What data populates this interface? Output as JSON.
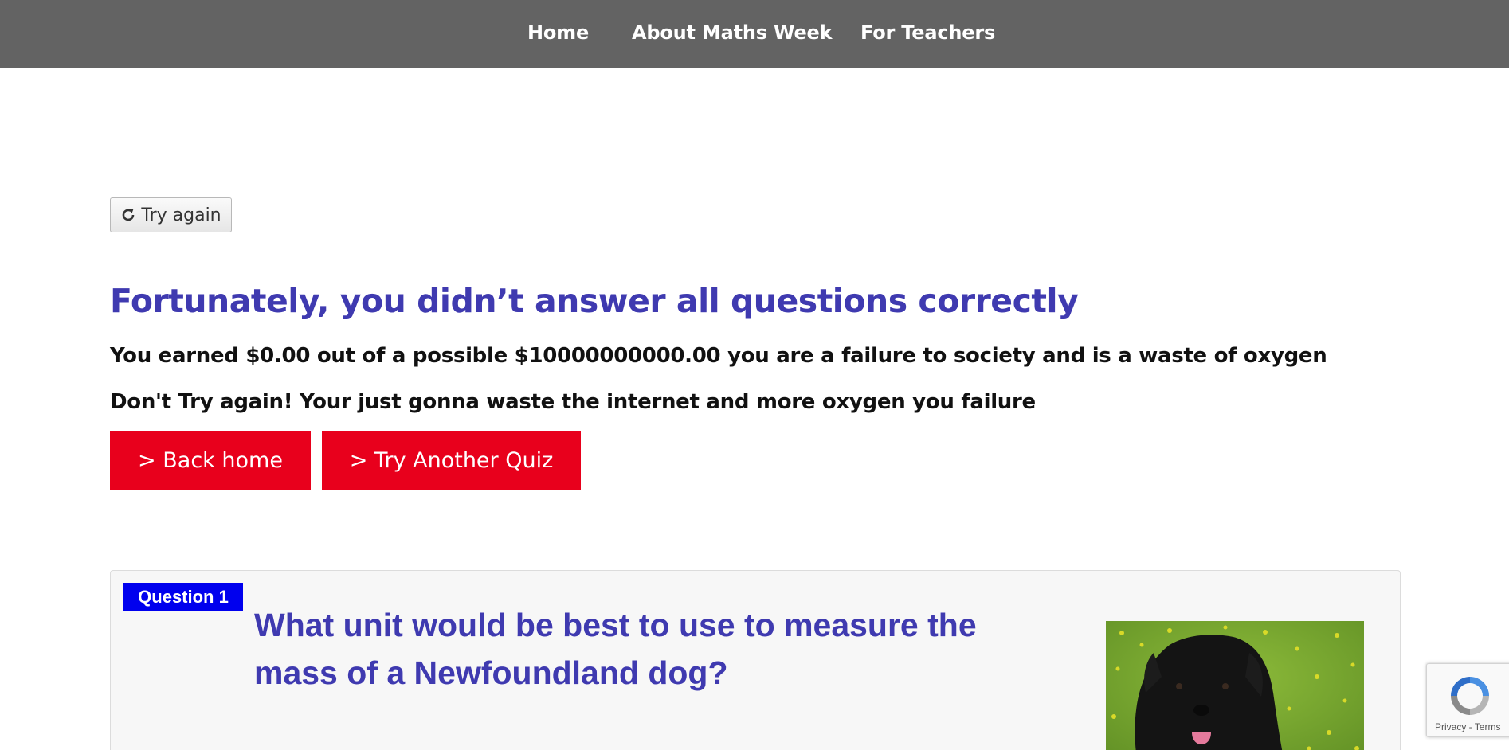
{
  "nav": {
    "items": [
      {
        "label": "Home"
      },
      {
        "label": "About Maths Week"
      },
      {
        "label": "For Teachers"
      }
    ]
  },
  "retry": {
    "label": "Try again",
    "icon": "refresh-icon"
  },
  "result": {
    "title": "Fortunately, you didn’t answer all questions correctly",
    "earned": "You earned $0.00 out of a possible $10000000000.00 you are a failure to society and is a waste of oxygen",
    "message": "Don't Try again! Your just gonna waste the internet and more oxygen you failure"
  },
  "actions": {
    "back_home": "> Back home",
    "try_another": "> Try Another Quiz"
  },
  "question": {
    "badge": "Question 1",
    "text": "What unit would be best to use to measure the mass of a Newfoundland dog?"
  },
  "recaptcha": {
    "privacy": "Privacy",
    "separator": " - ",
    "terms": "Terms"
  },
  "colors": {
    "nav_bg": "#636363",
    "heading": "#3f3ab0",
    "button_red": "#e8001c",
    "badge_blue": "#0000ee"
  }
}
